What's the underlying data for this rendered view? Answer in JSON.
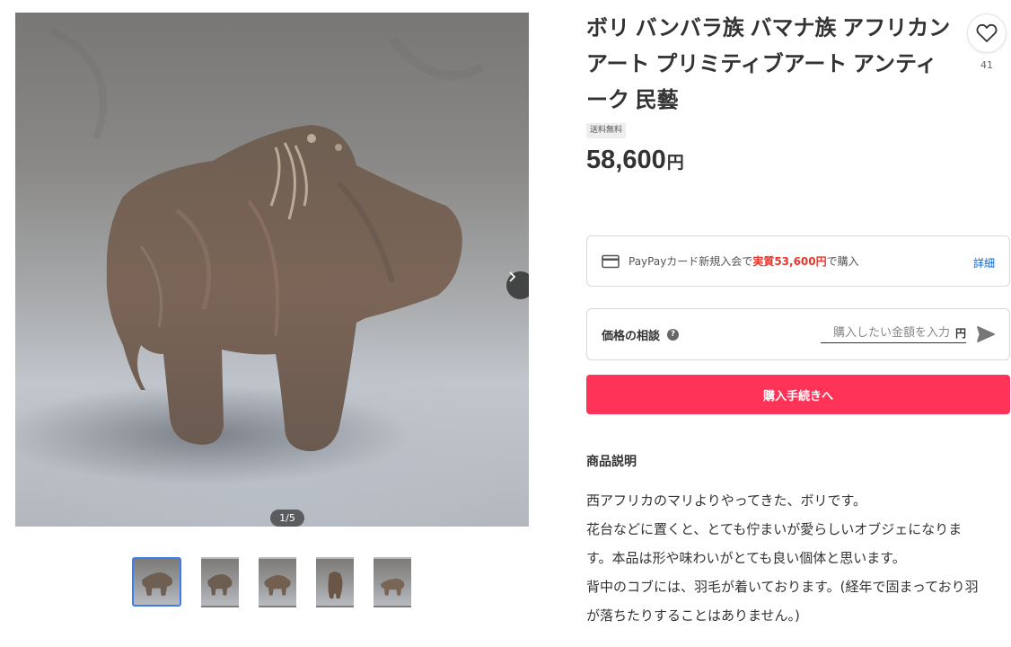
{
  "gallery": {
    "counter": "1/5",
    "image_alt": "main-product-photo",
    "thumbnails": [
      "thumb-1",
      "thumb-2",
      "thumb-3",
      "thumb-4",
      "thumb-5"
    ],
    "active_thumbnail": 1,
    "next_icon": "chevron-right-icon"
  },
  "product": {
    "title": "ボリ バンバラ族 バマナ族 アフリカンアート プリミティブアート アンティーク 民藝",
    "like_count": "41",
    "like_icon": "heart-icon",
    "shipping_badge": "送料無料",
    "price": "58,600",
    "currency": "円"
  },
  "paypay": {
    "icon": "credit-card-icon",
    "text_before": "PayPayカード新規入会で",
    "text_highlight": "実質53,600円",
    "text_after": "で購入",
    "detail_link": "詳細",
    "highlight_color": "#ea352d"
  },
  "offer": {
    "label": "価格の相談",
    "help_icon": "question-icon",
    "input_placeholder": "購入したい金額を入力",
    "input_value": "",
    "unit": "円",
    "send_icon": "send-icon"
  },
  "buy_button": {
    "label": "購入手続きへ",
    "color": "#ff3358"
  },
  "description": {
    "heading": "商品説明",
    "lines": [
      "西アフリカのマリよりやってきた、ボリです。",
      "花台などに置くと、とても佇まいが愛らしいオブジェになりま",
      "す。本品は形や味わいがとても良い個体と思います。",
      "背中のコブには、羽毛が着いております。(経年で固まっており羽",
      "が落ちたりすることはありません。)"
    ]
  }
}
